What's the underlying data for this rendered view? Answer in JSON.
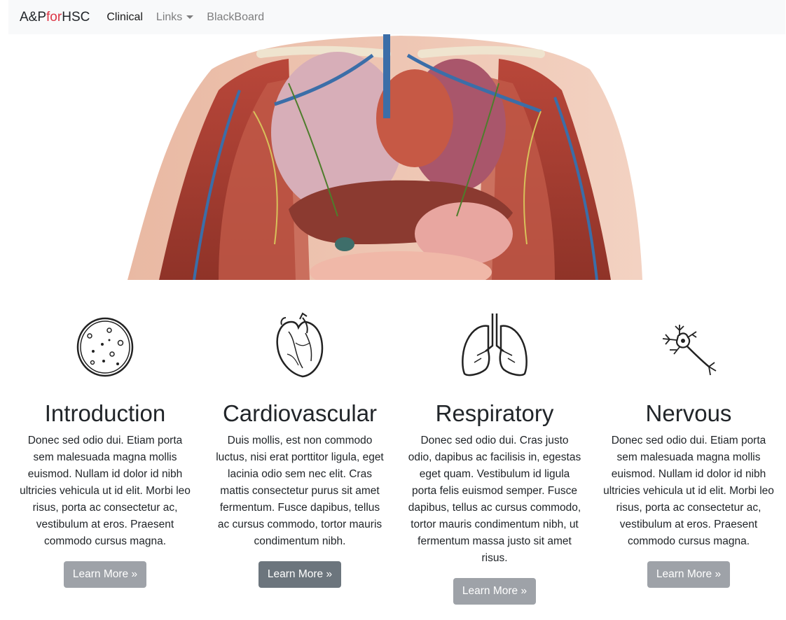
{
  "nav": {
    "brand_part1": "A&P",
    "brand_accent": "for",
    "brand_part2": "HSC",
    "links": [
      {
        "label": "Clinical"
      },
      {
        "label": "Links"
      },
      {
        "label": "BlackBoard"
      }
    ]
  },
  "hero": {
    "image_alt": "anatomy-illustration"
  },
  "sections": [
    {
      "title": "Introduction",
      "text": "Donec sed odio dui. Etiam porta sem malesuada magna mollis euismod. Nullam id dolor id nibh ultricies vehicula ut id elit. Morbi leo risus, porta ac consectetur ac, vestibulum at eros. Praesent commodo cursus magna.",
      "button": "Learn More »",
      "icon": "cell-icon"
    },
    {
      "title": "Cardiovascular",
      "text": "Duis mollis, est non commodo luctus, nisi erat porttitor ligula, eget lacinia odio sem nec elit. Cras mattis consectetur purus sit amet fermentum. Fusce dapibus, tellus ac cursus commodo, tortor mauris condimentum nibh.",
      "button": "Learn More »",
      "icon": "heart-icon"
    },
    {
      "title": "Respiratory",
      "text": "Donec sed odio dui. Cras justo odio, dapibus ac facilisis in, egestas eget quam. Vestibulum id ligula porta felis euismod semper. Fusce dapibus, tellus ac cursus commodo, tortor mauris condimentum nibh, ut fermentum massa justo sit amet risus.",
      "button": "Learn More »",
      "icon": "lungs-icon"
    },
    {
      "title": "Nervous",
      "text": "Donec sed odio dui. Etiam porta sem malesuada magna mollis euismod. Nullam id dolor id nibh ultricies vehicula ut id elit. Morbi leo risus, porta ac consectetur ac, vestibulum at eros. Praesent commodo cursus magna.",
      "button": "Learn More »",
      "icon": "neuron-icon"
    }
  ],
  "colors": {
    "accent": "#dc3545",
    "button": "#9ea2a8",
    "button_active": "#6c757d",
    "navbar": "#f8f9fa"
  }
}
